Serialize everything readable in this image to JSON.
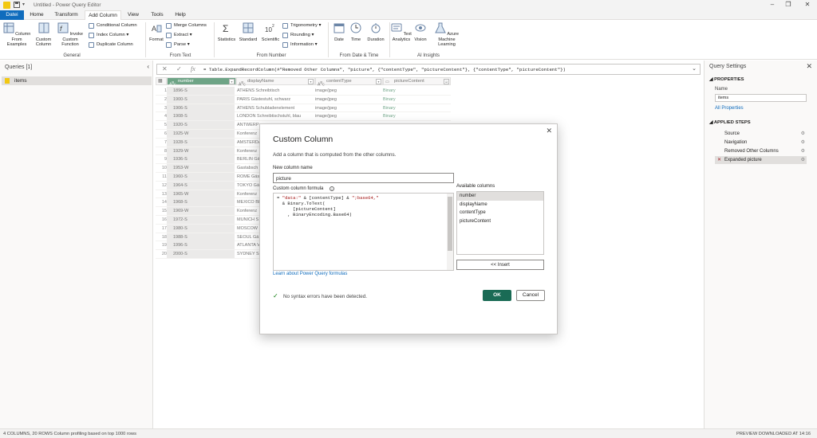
{
  "window": {
    "title": "Untitled - Power Query Editor"
  },
  "tabs": [
    "Datei",
    "Home",
    "Transform",
    "Add Column",
    "View",
    "Tools",
    "Help"
  ],
  "ribbon": {
    "general": {
      "label": "General",
      "col_from_examples": "Column From Examples",
      "custom_column": "Custom Column",
      "invoke_custom_function": "Invoke Custom Function",
      "conditional_column": "Conditional Column",
      "index_column": "Index Column",
      "duplicate_column": "Duplicate Column"
    },
    "from_text": {
      "label": "From Text",
      "format": "Format",
      "merge_columns": "Merge Columns",
      "extract": "Extract",
      "parse": "Parse"
    },
    "from_number": {
      "label": "From Number",
      "statistics": "Statistics",
      "standard": "Standard",
      "scientific": "Scientific",
      "trigonometry": "Trigonometry",
      "rounding": "Rounding",
      "information": "Information"
    },
    "from_date_time": {
      "label": "From Date & Time",
      "date": "Date",
      "time": "Time",
      "duration": "Duration"
    },
    "ai_insights": {
      "label": "AI Insights",
      "text_analytics": "Text Analytics",
      "vision": "Vision",
      "azure_ml": "Azure Machine Learning"
    }
  },
  "queries": {
    "header": "Queries [1]",
    "items": [
      "items"
    ]
  },
  "formula_bar": {
    "formula": "= Table.ExpandRecordColumn(#\"Removed Other Columns\", \"picture\", {\"contentType\", \"pictureContent\"}, {\"contentType\", \"pictureContent\"})"
  },
  "grid": {
    "columns": [
      "number",
      "displayName",
      "contentType",
      "pictureContent"
    ],
    "rows": [
      [
        "1",
        "1896-S",
        "ATHENS Schreibtisch",
        "image/jpeg",
        "Binary"
      ],
      [
        "2",
        "1900-S",
        "PARIS Gästestuhl, schwarz",
        "image/jpeg",
        "Binary"
      ],
      [
        "3",
        "1906-S",
        "ATHENS Schubladenelement",
        "image/jpeg",
        "Binary"
      ],
      [
        "4",
        "1908-S",
        "LONDON Schreibtischstuhl, blau",
        "image/jpeg",
        "Binary"
      ],
      [
        "5",
        "1920-S",
        "ANTWERP",
        "",
        ""
      ],
      [
        "6",
        "1925-W",
        "Konferenz",
        "",
        ""
      ],
      [
        "7",
        "1928-S",
        "AMSTERDA",
        "",
        ""
      ],
      [
        "8",
        "1929-W",
        "Konferenz",
        "",
        ""
      ],
      [
        "9",
        "1936-S",
        "BERLIN Gä",
        "",
        ""
      ],
      [
        "10",
        "1953-W",
        "Gastabsch",
        "",
        ""
      ],
      [
        "11",
        "1960-S",
        "ROME Gäs",
        "",
        ""
      ],
      [
        "12",
        "1964-S",
        "TOKYO Gä",
        "",
        ""
      ],
      [
        "13",
        "1965-W",
        "Konferenz",
        "",
        ""
      ],
      [
        "14",
        "1968-S",
        "MEXICO BL",
        "",
        ""
      ],
      [
        "15",
        "1969-W",
        "Konferenz",
        "",
        ""
      ],
      [
        "16",
        "1972-S",
        "MUNICH S",
        "",
        ""
      ],
      [
        "17",
        "1980-S",
        "MOSCOW",
        "",
        ""
      ],
      [
        "18",
        "1988-S",
        "SEOUL Gä",
        "",
        ""
      ],
      [
        "19",
        "1996-S",
        "ATLANTA V",
        "",
        ""
      ],
      [
        "20",
        "2000-S",
        "SYDNEY Sc",
        "",
        ""
      ]
    ]
  },
  "settings": {
    "header": "Query Settings",
    "properties": "PROPERTIES",
    "name_label": "Name",
    "name_value": "items",
    "all_properties": "All Properties",
    "applied_steps": "APPLIED STEPS",
    "steps": [
      "Source",
      "Navigation",
      "Removed Other Columns",
      "Expanded picture"
    ]
  },
  "dialog": {
    "title": "Custom Column",
    "description": "Add a column that is computed from the other columns.",
    "new_column_label": "New column name",
    "new_column_value": "picture",
    "formula_label": "Custom column formula",
    "formula_line1_a": "= ",
    "formula_line1_str1": "\"data:\"",
    "formula_line1_b": " & [contentType] & ",
    "formula_line1_str2": "\";base64,\"",
    "formula_line2": "  & Binary.ToText(",
    "formula_line3": "      [pictureContent]",
    "formula_line4": "    , BinaryEncoding.Base64)",
    "available_label": "Available columns",
    "available": [
      "number",
      "displayName",
      "contentType",
      "pictureContent"
    ],
    "insert": "<< Insert",
    "learn": "Learn about Power Query formulas",
    "syntax": "No syntax errors have been detected.",
    "ok": "OK",
    "cancel": "Cancel"
  },
  "status": {
    "left": "4 COLUMNS, 20 ROWS     Column profiling based on top 1000 rows",
    "right": "PREVIEW DOWNLOADED AT 14:16"
  }
}
